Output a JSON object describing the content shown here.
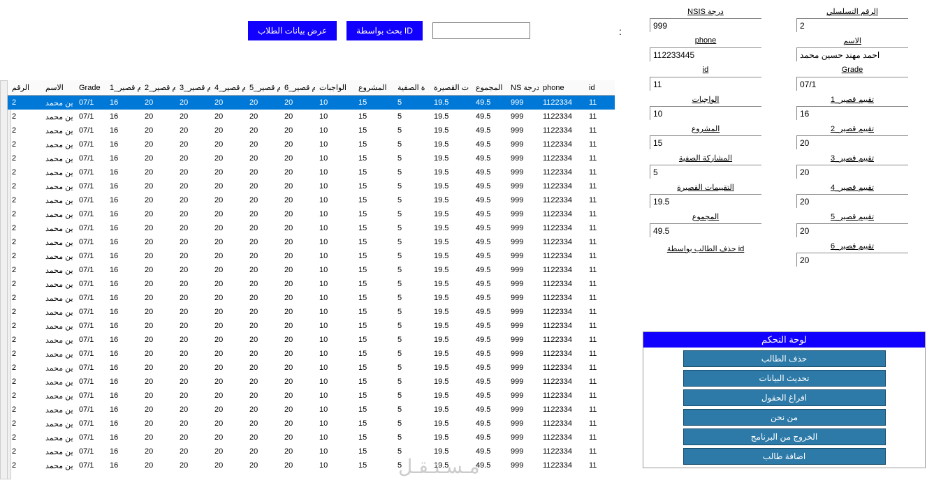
{
  "top": {
    "btn_view": "عرض بيانات الطلاب",
    "btn_search": "بحث بواسطة ID",
    "search_value": "",
    "dots": ":"
  },
  "fields_left": [
    {
      "label": "NSIS درجة",
      "value": "999"
    },
    {
      "label": "phone",
      "value": "112233445"
    },
    {
      "label": "id",
      "value": "11"
    },
    {
      "label": "الواجبات",
      "value": "10"
    },
    {
      "label": "المشروع",
      "value": "15"
    },
    {
      "label": "المشاركة الصفية",
      "value": "5"
    },
    {
      "label": "التقييمات القصيرة",
      "value": "19.5"
    },
    {
      "label": "المجموع",
      "value": "49.5"
    }
  ],
  "delete_label": "حذف الطالب بواسطة id",
  "fields_right": [
    {
      "label": "الرقم التسلسلي",
      "value": "2"
    },
    {
      "label": "الاسم",
      "value": "احمد مهند حسين محمد"
    },
    {
      "label": "Grade",
      "value": "07/1"
    },
    {
      "label": "تقييم قصير_1",
      "value": "16"
    },
    {
      "label": "تقييم قصير_2",
      "value": "20"
    },
    {
      "label": "تقييم قصير_3",
      "value": "20"
    },
    {
      "label": "تقييم قصير_4",
      "value": "20"
    },
    {
      "label": "تقييم قصير_5",
      "value": "20"
    },
    {
      "label": "تقييم قصير_6",
      "value": "20"
    }
  ],
  "control_panel": {
    "title": "لوحة التحكم",
    "buttons": [
      "حذف الطالب",
      "تحديث البيانات",
      "افراغ الحقول",
      "من نحن",
      "الخروج من البرنامج",
      "اضافة طالب"
    ]
  },
  "grid": {
    "headers": [
      "الرقم",
      "الاسم",
      "Grade",
      "م قصير_1",
      "م قصير_2",
      "م قصير_3",
      "م قصير_4",
      "م قصير_5",
      "م قصير_6",
      "الواجبات",
      "المشروع",
      "ة الصفية",
      "ت القصيرة",
      "المجموع",
      "NS درجة",
      "phone",
      "id"
    ],
    "row": {
      "num": "2",
      "name": "ين محمد",
      "grade": "07/1",
      "q1": "16",
      "q2": "20",
      "q3": "20",
      "q4": "20",
      "q5": "20",
      "q6": "20",
      "hw": "10",
      "proj": "15",
      "class": "5",
      "short": "19.5",
      "sum": "49.5",
      "ns": "999",
      "phone": "1122334",
      "id": "11"
    },
    "row_count": 27
  },
  "watermark": "مـسـتـقـل"
}
